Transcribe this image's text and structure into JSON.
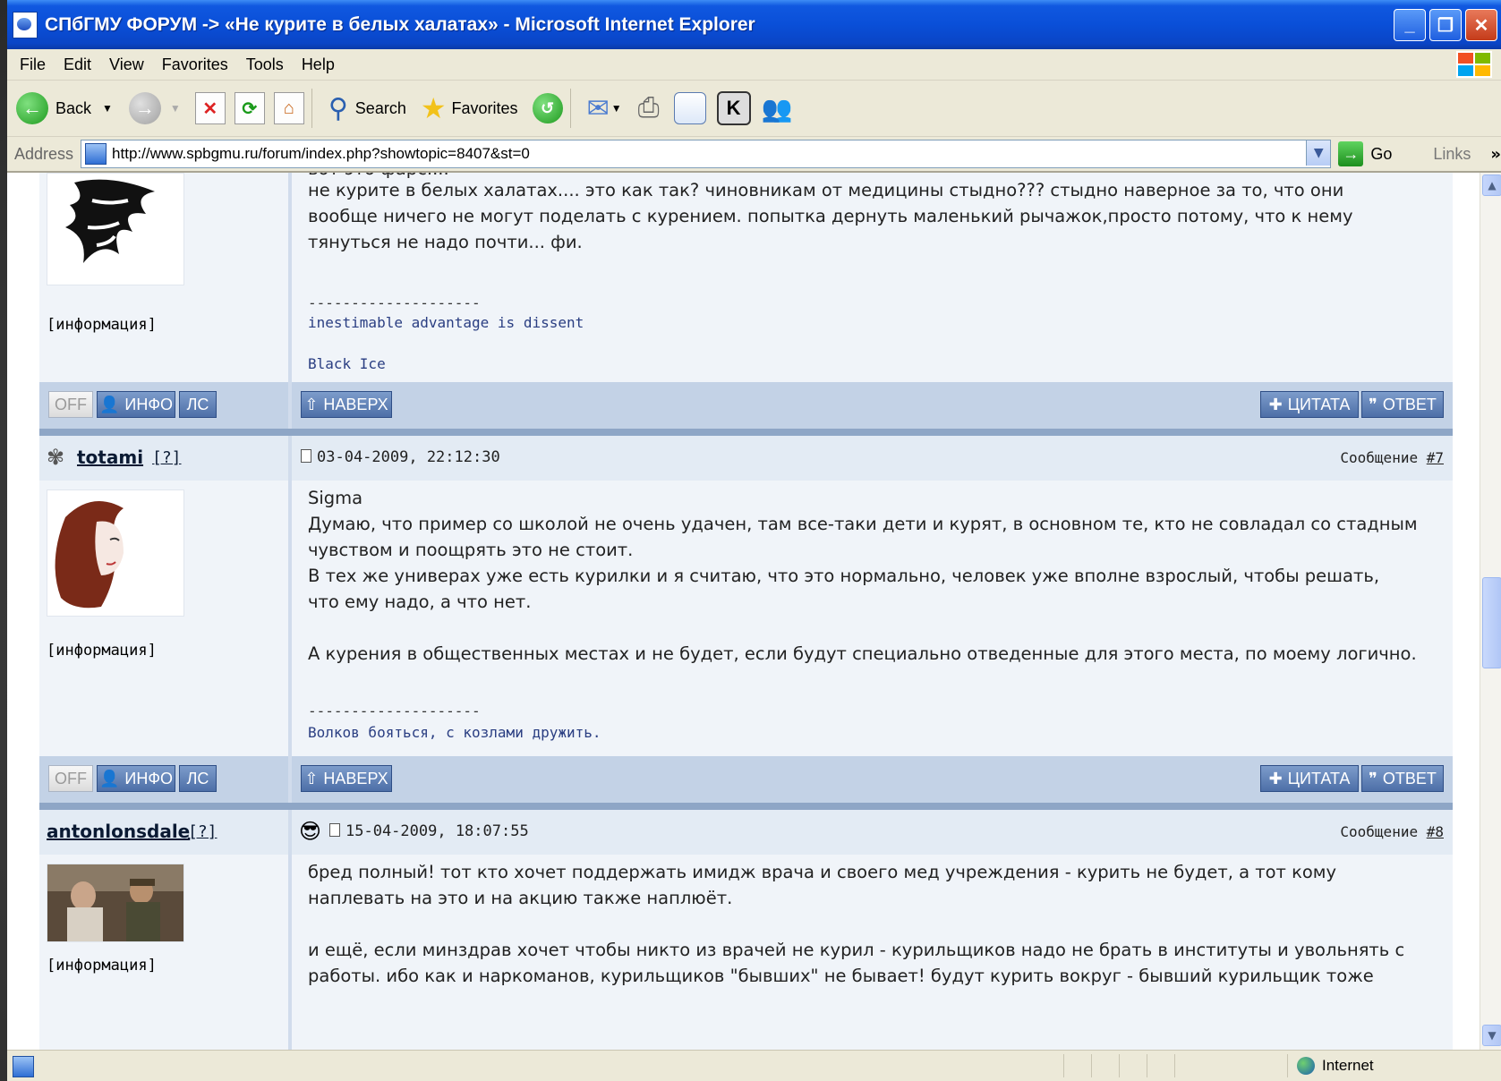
{
  "window": {
    "title": "СПбГМУ ФОРУМ -> «Не курите в белых халатах» - Microsoft Internet Explorer"
  },
  "menu": [
    "File",
    "Edit",
    "View",
    "Favorites",
    "Tools",
    "Help"
  ],
  "toolbar": {
    "back_label": "Back",
    "search_label": "Search",
    "favorites_label": "Favorites"
  },
  "address": {
    "label": "Address",
    "url": "http://www.spbgmu.ru/forum/index.php?showtopic=8407&st=0",
    "go_label": "Go",
    "links_label": "Links"
  },
  "forum": {
    "buttons": {
      "off": "OFF",
      "info": "ИНФО",
      "pm": "ЛС",
      "top": "НАВЕРХ",
      "quote": "ЦИТАТА",
      "reply": "ОТВЕТ"
    },
    "info_label": "[информация]",
    "question": "[?]",
    "post_label": "Сообщение",
    "posts": [
      {
        "partial_top_line": "вот это фарс....",
        "body": [
          "не курите в белых халатах.... это как так? чиновникам от медицины стыдно??? стыдно наверное за то, что они",
          "вообще ничего не могут поделать с курением. попытка дернуть маленький рычажок,просто потому, что к нему",
          "тянуться не надо почти... фи."
        ],
        "sig_separator": "--------------------",
        "signature": [
          "inestimable advantage is dissent",
          "Black Ice"
        ]
      },
      {
        "author": "totami",
        "date": "03-04-2009, 22:12:30",
        "number": "#7",
        "body": [
          "Sigma",
          "Думаю, что пример со школой не очень удачен, там все-таки дети и курят, в основном те, кто не совладал со стадным",
          "чувством и поощрять это не стоит.",
          "В тех же универах уже есть курилки и я считаю, что это нормально, человек уже вполне взрослый, чтобы решать,",
          "что ему надо, а что нет.",
          "",
          "А курения в общественных местах и не будет, если будут специально отведенные для этого места, по моему логично."
        ],
        "sig_separator": "--------------------",
        "signature": [
          "Волков бояться, с козлами дружить."
        ]
      },
      {
        "author": "antonlonsdale",
        "date": "15-04-2009, 18:07:55",
        "number": "#8",
        "body": [
          "бред полный! тот кто хочет поддержать имидж врача и своего мед учреждения - курить не будет, а тот кому",
          "наплевать на это и на акцию также наплюёт.",
          "",
          "и ещё, если минздрав хочет чтобы никто из врачей не курил - курильщиков надо не брать в институты и увольнять с",
          "работы. ибо как и наркоманов, курильщиков \"бывших\" не бывает! будут курить вокруг - бывший курильщик тоже"
        ]
      }
    ]
  },
  "status": {
    "zone": "Internet"
  }
}
